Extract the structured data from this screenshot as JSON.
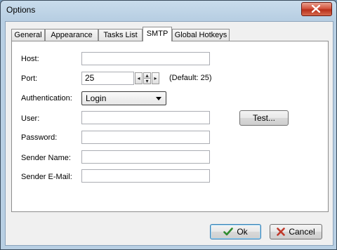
{
  "window": {
    "title": "Options"
  },
  "tabs": [
    {
      "label": "General"
    },
    {
      "label": "Appearance"
    },
    {
      "label": "Tasks List"
    },
    {
      "label": "SMTP",
      "active": true
    },
    {
      "label": "Global Hotkeys"
    }
  ],
  "smtp": {
    "host_label": "Host:",
    "host_value": "",
    "port_label": "Port:",
    "port_value": "25",
    "port_default": "(Default: 25)",
    "auth_label": "Authentication:",
    "auth_value": "Login",
    "user_label": "User:",
    "user_value": "",
    "test_label": "Test...",
    "password_label": "Password:",
    "password_value": "",
    "sender_name_label": "Sender Name:",
    "sender_name_value": "",
    "sender_email_label": "Sender E-Mail:",
    "sender_email_value": ""
  },
  "footer": {
    "ok_label": "Ok",
    "cancel_label": "Cancel"
  },
  "colors": {
    "ok_check": "#2e8b2e",
    "cancel_x": "#c0392b",
    "close_button": "#c9442c"
  },
  "icons": [
    "close-icon",
    "check-icon",
    "x-icon",
    "spin-left-icon",
    "spin-up-icon",
    "spin-down-icon",
    "spin-right-icon",
    "dropdown-arrow-icon"
  ]
}
